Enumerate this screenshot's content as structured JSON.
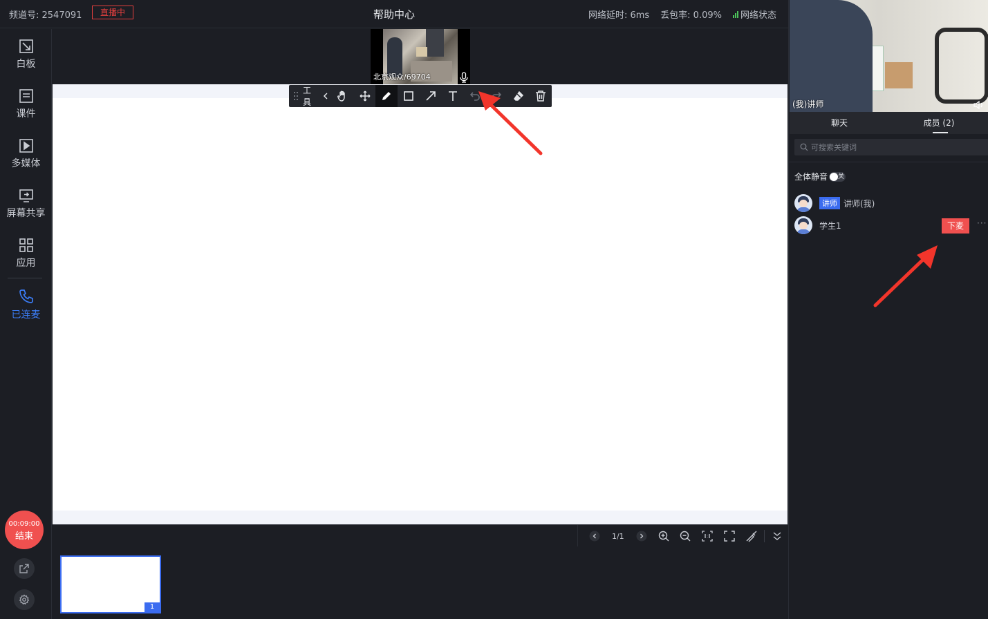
{
  "topbar": {
    "channel": "频道号: 2547091",
    "live_badge": "直播中",
    "title": "帮助中心",
    "latency": "网络延时: 6ms",
    "packet_loss": "丢包率: 0.09%",
    "network_status": "网络状态"
  },
  "sidebar": {
    "items": [
      {
        "label": "白板",
        "icon": "whiteboard-icon"
      },
      {
        "label": "课件",
        "icon": "courseware-icon"
      },
      {
        "label": "多媒体",
        "icon": "media-play-icon"
      },
      {
        "label": "屏幕共享",
        "icon": "screen-share-icon"
      },
      {
        "label": "应用",
        "icon": "apps-grid-icon"
      },
      {
        "label": "已连麦",
        "icon": "phone-icon"
      }
    ],
    "end_button": {
      "time": "00:09:00",
      "label": "结束"
    }
  },
  "audience_video": {
    "name": "北京观众/69704"
  },
  "toolbar": {
    "label": "工具",
    "tools": [
      "hand-icon",
      "move-icon",
      "pen-icon",
      "rectangle-icon",
      "arrow-icon",
      "text-icon",
      "undo-icon",
      "redo-icon",
      "eraser-icon",
      "trash-icon"
    ],
    "selected": "pen-icon"
  },
  "page_controls": {
    "page": "1/1"
  },
  "thumbnails": [
    {
      "number": "1"
    }
  ],
  "right_panel": {
    "teacher_video_label": "(我)讲师",
    "tabs": [
      {
        "label": "聊天"
      },
      {
        "label": "成员 (2)"
      }
    ],
    "active_tab": 1,
    "search_placeholder": "可搜索关键词",
    "mute_all_label": "全体静音",
    "mute_toggle_text": "关",
    "members": [
      {
        "role": "讲师",
        "name": "讲师(我)"
      },
      {
        "name": "学生1",
        "action": "下麦",
        "more": "···"
      }
    ]
  },
  "colors": {
    "accent": "#3b6cf0",
    "danger": "#f0504f",
    "background": "#1c1e24"
  }
}
